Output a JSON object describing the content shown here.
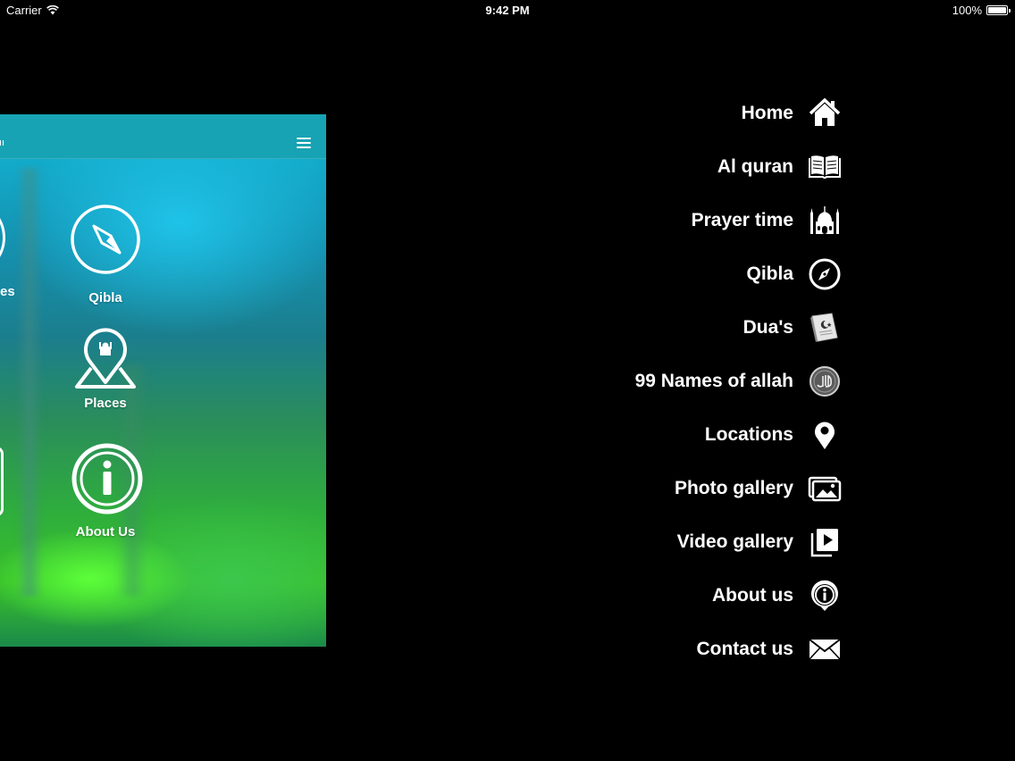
{
  "status_bar": {
    "carrier": "Carrier",
    "time": "9:42 PM",
    "battery": "100%"
  },
  "app_preview": {
    "tiles": [
      {
        "label": "Qibla",
        "icon": "compass-icon"
      },
      {
        "label": "Places",
        "icon": "map-pin-mosque-icon"
      },
      {
        "label": "About Us",
        "icon": "info-icon"
      }
    ],
    "partial_label": "es",
    "header_icon": "hamburger-menu-icon"
  },
  "menu": {
    "items": [
      {
        "label": "Home",
        "icon": "home-icon"
      },
      {
        "label": "Al quran",
        "icon": "open-book-icon"
      },
      {
        "label": "Prayer time",
        "icon": "mosque-icon"
      },
      {
        "label": "Qibla",
        "icon": "compass-icon"
      },
      {
        "label": "Dua's",
        "icon": "prayer-book-icon"
      },
      {
        "label": "99 Names of allah",
        "icon": "allah-calligraphy-icon"
      },
      {
        "label": "Locations",
        "icon": "location-pin-icon"
      },
      {
        "label": "Photo gallery",
        "icon": "photo-gallery-icon"
      },
      {
        "label": "Video gallery",
        "icon": "video-gallery-icon"
      },
      {
        "label": "About us",
        "icon": "info-pin-icon"
      },
      {
        "label": "Contact us",
        "icon": "envelope-icon"
      }
    ]
  },
  "colors": {
    "background": "#000000",
    "header": "#17a3b4",
    "text": "#ffffff"
  }
}
